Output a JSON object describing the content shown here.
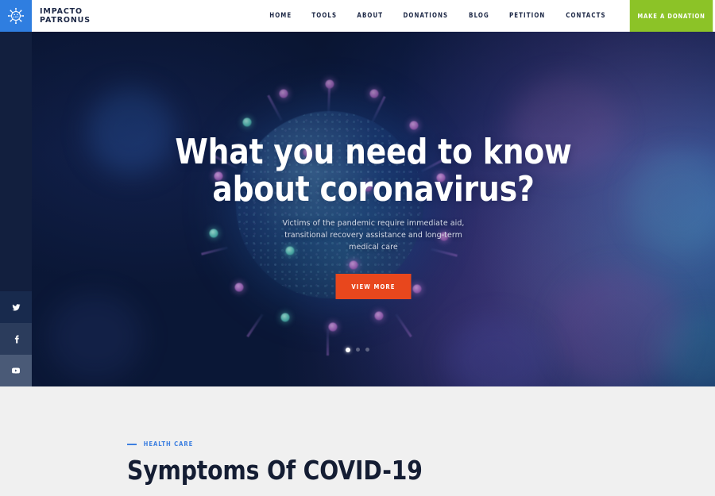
{
  "header": {
    "logo": {
      "icon": "virus-icon",
      "line1": "IMPACTO",
      "line2": "PATRONUS",
      "box_color": "#2f7ee0"
    },
    "nav_items": [
      {
        "label": "HOME"
      },
      {
        "label": "TOOLS"
      },
      {
        "label": "ABOUT"
      },
      {
        "label": "DONATIONS"
      },
      {
        "label": "BLOG"
      },
      {
        "label": "PETITION"
      },
      {
        "label": "CONTACTS"
      }
    ],
    "donate_button": {
      "label": "MAKE A DONATION",
      "color": "#8cc327"
    }
  },
  "hero": {
    "title": "What you need to know about coronavirus?",
    "subtitle": "Victims of the pandemic require immediate aid, transitional recovery assistance and long-term medical care",
    "cta_label": "VIEW MORE",
    "cta_color": "#e8471d",
    "background_color": "#0b1838",
    "slides": [
      {
        "active": true
      },
      {
        "active": false
      },
      {
        "active": false
      }
    ]
  },
  "social_rail": {
    "items": [
      {
        "name": "twitter",
        "icon": "twitter-icon"
      },
      {
        "name": "facebook",
        "icon": "facebook-icon"
      },
      {
        "name": "youtube",
        "icon": "youtube-icon"
      }
    ]
  },
  "section": {
    "eyebrow": "HEALTH CARE",
    "eyebrow_color": "#3d7fe0",
    "title": "Symptoms Of COVID-19",
    "background_color": "#f0f0f0"
  }
}
